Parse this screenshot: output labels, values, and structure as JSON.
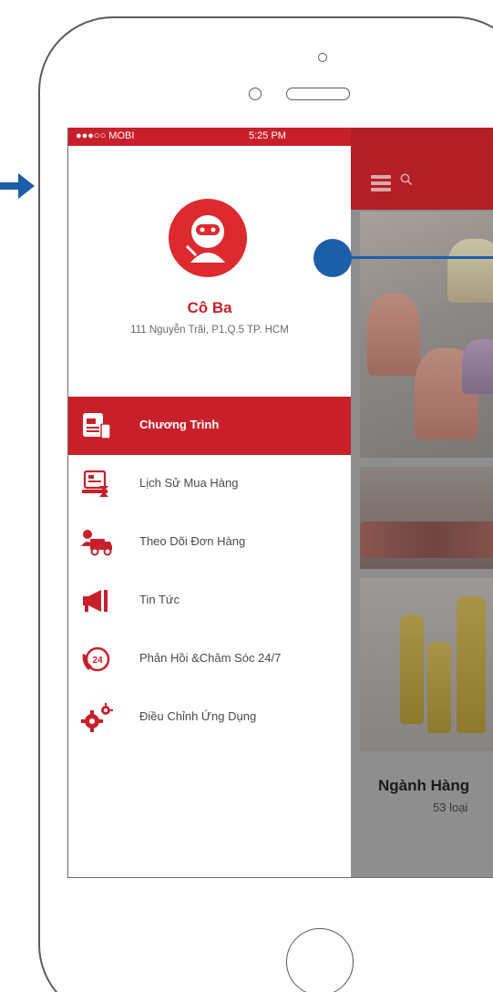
{
  "status_bar": {
    "carrier": "●●●○○ MOBI",
    "time": "5:25 PM"
  },
  "user": {
    "name": "Cô Ba",
    "address": "111 Nguyễn Trãi, P1,Q.5 TP. HCM"
  },
  "menu": {
    "items": [
      {
        "label": "Chương Trình",
        "icon": "program-icon",
        "active": true
      },
      {
        "label": "Lịch Sử Mua Hàng",
        "icon": "purchase-history-icon",
        "active": false
      },
      {
        "label": "Theo Dõi Đơn Hàng",
        "icon": "delivery-truck-icon",
        "active": false
      },
      {
        "label": "Tin Tức",
        "icon": "megaphone-icon",
        "active": false
      },
      {
        "label": "Phản Hồi &Chăm Sóc 24/7",
        "icon": "support-24-icon",
        "active": false
      },
      {
        "label": "Điều Chỉnh Ứng Dụng",
        "icon": "gears-icon",
        "active": false
      }
    ]
  },
  "background_app": {
    "category_title": "Ngành Hàng",
    "category_count": "53 loại"
  },
  "colors": {
    "brand_red": "#c8202b",
    "annotation_blue": "#1d5ea8"
  }
}
